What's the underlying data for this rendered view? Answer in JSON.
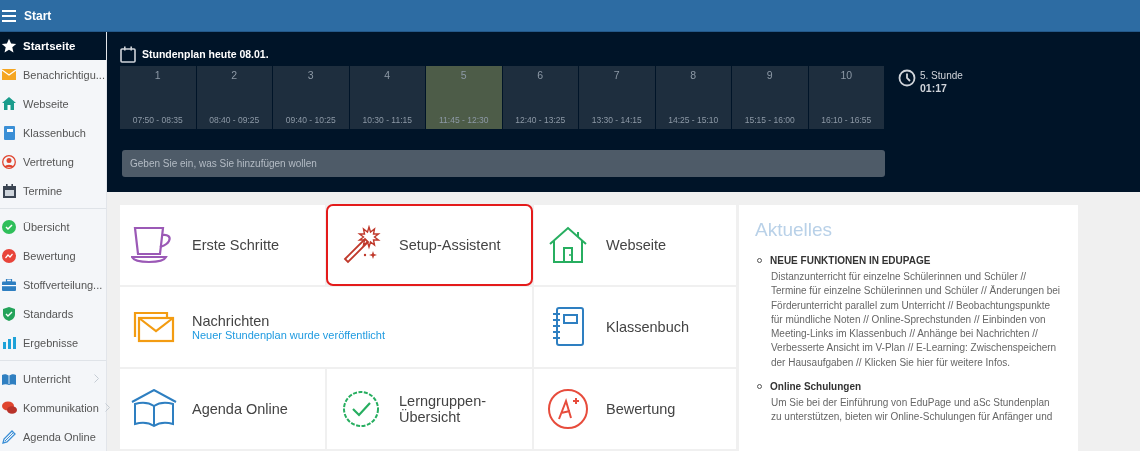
{
  "topbar": {
    "title": "Start"
  },
  "sidebar": {
    "groups": [
      {
        "items": [
          {
            "label": "Startseite",
            "selected": true,
            "has_submenu": false
          }
        ]
      },
      {
        "items": [
          {
            "label": "Benachrichtigu...",
            "selected": false,
            "has_submenu": false
          },
          {
            "label": "Webseite",
            "selected": false,
            "has_submenu": false
          },
          {
            "label": "Klassenbuch",
            "selected": false,
            "has_submenu": false
          },
          {
            "label": "Vertretung",
            "selected": false,
            "has_submenu": false
          },
          {
            "label": "Termine",
            "selected": false,
            "has_submenu": false
          }
        ]
      },
      {
        "items": [
          {
            "label": "Übersicht",
            "selected": false,
            "has_submenu": false
          },
          {
            "label": "Bewertung",
            "selected": false,
            "has_submenu": false
          },
          {
            "label": "Stoffverteilung...",
            "selected": false,
            "has_submenu": false
          },
          {
            "label": "Standards",
            "selected": false,
            "has_submenu": false
          },
          {
            "label": "Ergebnisse",
            "selected": false,
            "has_submenu": false
          }
        ]
      },
      {
        "items": [
          {
            "label": "Unterricht",
            "selected": false,
            "has_submenu": true
          },
          {
            "label": "Kommunikation",
            "selected": false,
            "has_submenu": true
          },
          {
            "label": "Agenda Online",
            "selected": false,
            "has_submenu": false
          }
        ]
      }
    ]
  },
  "timetable": {
    "title": "Stundenplan heute 08.01.",
    "periods": [
      {
        "number": "1",
        "time": "07:50 - 08:35",
        "current": false
      },
      {
        "number": "2",
        "time": "08:40 - 09:25",
        "current": false
      },
      {
        "number": "3",
        "time": "09:40 - 10:25",
        "current": false
      },
      {
        "number": "4",
        "time": "10:30 - 11:15",
        "current": false
      },
      {
        "number": "5",
        "time": "11:45 - 12:30",
        "current": true
      },
      {
        "number": "6",
        "time": "12:40 - 13:25",
        "current": false
      },
      {
        "number": "7",
        "time": "13:30 - 14:15",
        "current": false
      },
      {
        "number": "8",
        "time": "14:25 - 15:10",
        "current": false
      },
      {
        "number": "9",
        "time": "15:15 - 16:00",
        "current": false
      },
      {
        "number": "10",
        "time": "16:10 - 16:55",
        "current": false
      }
    ],
    "current_lesson": {
      "label": "5. Stunde",
      "remaining": "01:17"
    }
  },
  "add_field": {
    "placeholder": "Geben Sie ein, was Sie hinzufügen wollen"
  },
  "tiles": [
    {
      "kind": "standard",
      "label": "Erste Schritte",
      "selected": false
    },
    {
      "kind": "standard",
      "label": "Setup-Assistent",
      "selected": true
    },
    {
      "kind": "standard",
      "label": "Webseite",
      "selected": false
    },
    {
      "kind": "wide",
      "label": "Nachrichten",
      "subtitle": "Neuer Stundenplan wurde veröffentlicht",
      "selected": false
    },
    {
      "kind": "standard",
      "label": "Klassenbuch",
      "selected": false
    },
    {
      "kind": "standard",
      "label": "Agenda Online",
      "selected": false
    },
    {
      "kind": "standard",
      "label": "Lerngruppen-Übersicht",
      "selected": false
    },
    {
      "kind": "standard",
      "label": "Bewertung",
      "selected": false
    }
  ],
  "news": {
    "title": "Aktuelles",
    "items": [
      {
        "title": "NEUE FUNKTIONEN IN EDUPAGE",
        "text": "Distanzunterricht für einzelne Schülerinnen und Schüler // Termine für einzelne Schülerinnen und Schüler // Änderungen bei Förderunterricht parallel zum Unterricht // Beobachtungspunkte für mündliche Noten // Online-Sprechstunden // Einbinden von Meeting-Links im Klassenbuch // Anhänge bei Nachrichten // Verbesserte Ansicht im V-Plan // E-Learning: Zwischenspeichern der Hausaufgaben // Klicken Sie hier für weitere Infos."
      },
      {
        "title": "Online Schulungen",
        "text": "Um Sie bei der Einführung von EduPage und aSc Stundenplan zu unterstützen, bieten wir Online-Schulungen für Anfänger und"
      }
    ]
  }
}
